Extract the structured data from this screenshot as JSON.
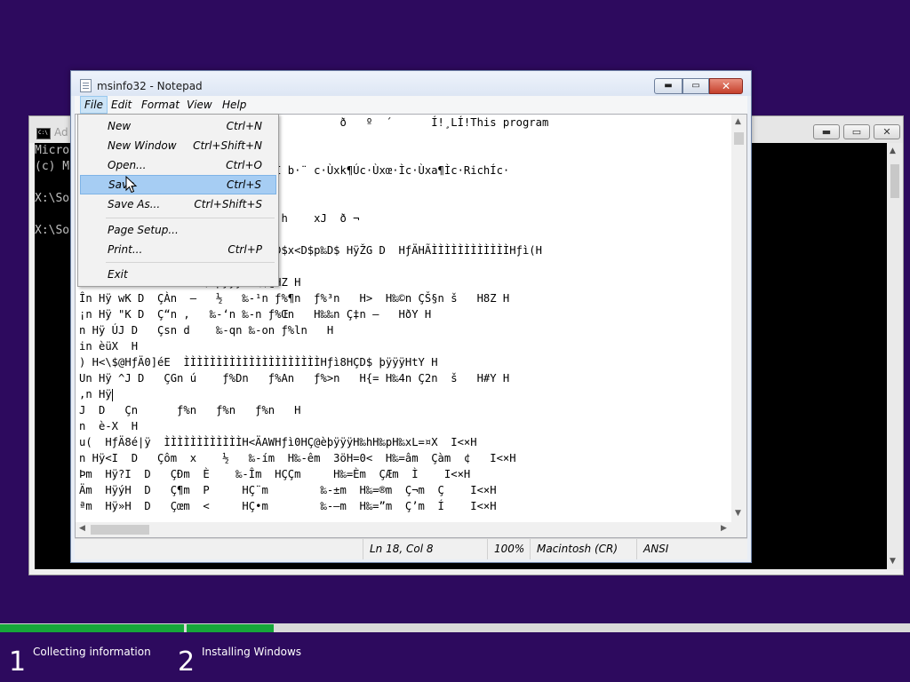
{
  "console": {
    "title": "Ad",
    "icon": "C:\\",
    "lines": [
      "Micro",
      "(c) M",
      "",
      "X:\\So",
      "",
      "X:\\So"
    ],
    "buttons": {
      "minimize": "▬",
      "maximize": "▭",
      "close": "✕"
    }
  },
  "notepad": {
    "title": "msinfo32 - Notepad",
    "buttons": {
      "minimize": "▬",
      "maximize": "▭",
      "close": "✕"
    },
    "menu": [
      "File",
      "Edit",
      "Format",
      "View",
      "Help"
    ],
    "text_lines": [
      "                                        ð   º  ´      Í!¸LÍ!This program",
      "",
      "                 <f¶Äc·Ùxb¶îc·Í b·¨ c·Ùxk¶Úc·Ùxœ·Ìc·Ùxa¶Ìc·RichÍc·",
      "",
      "                            ¤W h    xJ  ð ¬",
      "",
      "                 B   I<K HT$0‰D$x<D$p‰D$ HÿŽG D  HƒÄHÃÌÌÌÌÌÌÌÌÌÌÌÌHƒì(H",
      "                  D$ þÿÿÿH‰\\$@HZ H",
      "În Hÿ wK D  ÇÀn  –   ½   ‰-¹n ƒ%¶n  ƒ%³n   H>  H‰©n ÇŠ§n š   H8Z H",
      "¡n Hÿ \"K D  Ç“n ,   ‰-‘n ‰-n ƒ%Œn   H‰‰n Ç‡n –   HðY H",
      "n Hÿ ÚJ D   Çsn d    ‰-qn ‰-on ƒ%ln   H",
      "in èüX  H",
      ") H<\\$@HƒÄ0]éE  ÌÌÌÌÌÌÌÌÌÌÌÌÌÌÌÌÌÌÌÌÌHƒì8HÇD$ þÿÿÿHtY H",
      "Un Hÿ ^J D   ÇGn ú    ƒ%Dn   ƒ%An   ƒ%>n   H{= H‰4n Ç2n  š   H#Y H",
      ",n Hÿ",
      "J  D   Çn      ƒ%n   ƒ%n   ƒ%n   H",
      "n  è-X  H",
      "u(  HƒÄ8é|ÿ  ÌÌÌÌÌÌÌÌÌÌÌÌH<ÄAWHƒì0HÇ@èþÿÿÿH‰hH‰pH‰xL=¤X  I<×H",
      "n Hÿ<I  D   Çôm  x    ½   ‰-ím  H‰-êm  3öH=0<  H‰=âm  Çàm  ¢   I<×H",
      "Þm  Hÿ?I  D   ÇÐm  È    ‰-Îm  HÇÇm     H‰=Èm  ÇÆm  Ì    I<×H",
      "Äm  HÿýH  D   Ç¶m  P     HÇ¨m        ‰-±m  H‰=®m  Ç¬m  Ç    I<×H",
      "ªm  Hÿ»H  D   Çœm  <     HÇ•m        ‰-—m  H‰=”m  Ç’m  Í    I<×H"
    ],
    "status": {
      "position": "Ln 18, Col 8",
      "zoom": "100%",
      "line_ending": "Macintosh (CR)",
      "encoding": "ANSI"
    }
  },
  "file_menu": [
    {
      "label": "New",
      "shortcut": "Ctrl+N"
    },
    {
      "label": "New Window",
      "shortcut": "Ctrl+Shift+N"
    },
    {
      "label": "Open...",
      "shortcut": "Ctrl+O"
    },
    {
      "label": "Save",
      "shortcut": "Ctrl+S"
    },
    {
      "label": "Save As...",
      "shortcut": "Ctrl+Shift+S"
    },
    {
      "label": "Page Setup...",
      "shortcut": ""
    },
    {
      "label": "Print...",
      "shortcut": "Ctrl+P"
    },
    {
      "label": "Exit",
      "shortcut": ""
    }
  ],
  "setup": {
    "steps": [
      {
        "number": "1",
        "label": "Collecting information"
      },
      {
        "number": "2",
        "label": "Installing Windows"
      }
    ],
    "colors": {
      "progress": "#16a63a",
      "background": "#2d0a5e"
    }
  }
}
